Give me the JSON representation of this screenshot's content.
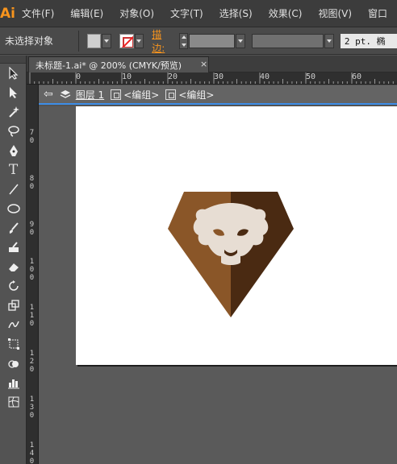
{
  "app": {
    "logo": "Ai"
  },
  "menu": [
    "文件(F)",
    "编辑(E)",
    "对象(O)",
    "文字(T)",
    "选择(S)",
    "效果(C)",
    "视图(V)",
    "窗口"
  ],
  "control": {
    "selection_label": "未选择对象",
    "stroke_label": "描边:",
    "stroke_weight": "2 pt. 椭"
  },
  "document_tab": {
    "title": "未标题-1.ai* @ 200% (CMYK/预览)",
    "close": "×"
  },
  "ruler": {
    "top_labels": [
      "0",
      "10",
      "20",
      "30",
      "40",
      "50",
      "60"
    ],
    "left_labels": [
      "7\n0",
      "8\n0",
      "9\n0",
      "1\n0\n0",
      "1\n1\n0",
      "1\n2\n0",
      "1\n3\n0",
      "1\n4\n0"
    ]
  },
  "isolation": {
    "layer": "图层 1",
    "group1": "<编组>",
    "group2": "<编组>"
  },
  "artwork": {
    "shield_left_color": "#8a5628",
    "shield_right_color": "#4a2a12",
    "face_color": "#e7ddd3",
    "face_shadow_color": "#d8cfc6"
  },
  "tools": [
    "selection-tool",
    "direct-selection-tool",
    "magic-wand-tool",
    "lasso-tool",
    "pen-tool",
    "type-tool",
    "line-tool",
    "ellipse-tool",
    "paintbrush-tool",
    "blob-brush-tool",
    "eraser-tool",
    "rotate-tool",
    "scale-tool",
    "warp-tool",
    "free-transform-tool",
    "shape-builder-tool",
    "graph-tool",
    "mesh-tool"
  ]
}
